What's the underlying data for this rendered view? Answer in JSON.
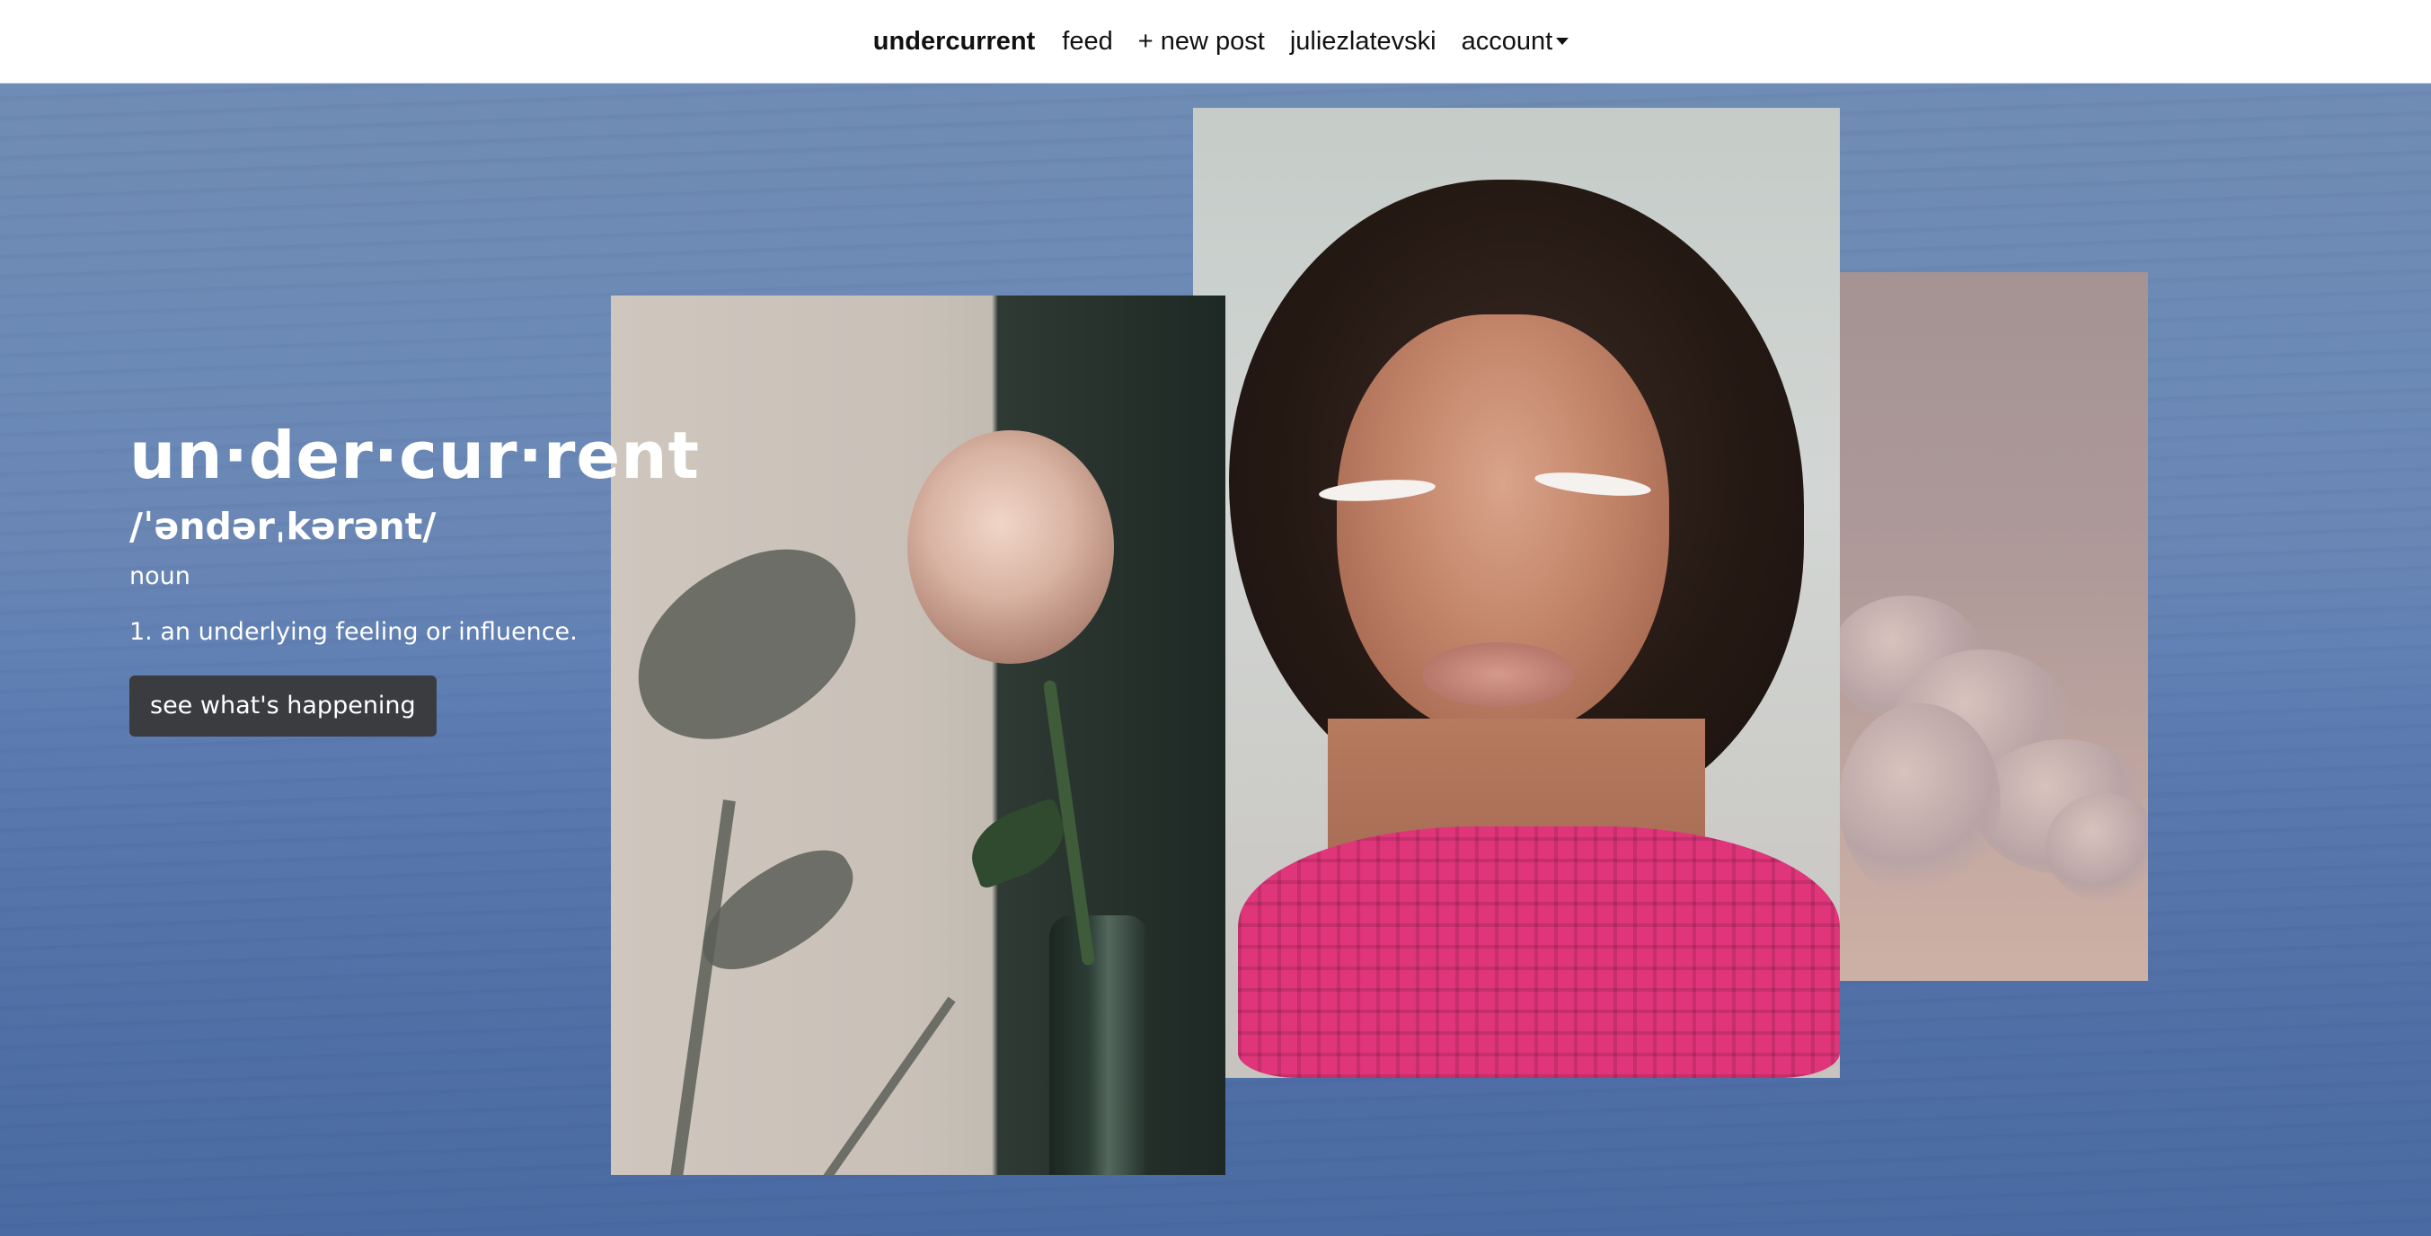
{
  "nav": {
    "brand": "undercurrent",
    "items": [
      {
        "label": "feed"
      },
      {
        "label": "+ new post"
      },
      {
        "label": "juliezlatevski"
      },
      {
        "label": "account"
      }
    ]
  },
  "definition": {
    "word": "un·der·cur·rent",
    "phonetic": "/ˈəndərˌkərənt/",
    "part_of_speech": "noun",
    "meaning": "1. an underlying feeling or influence.",
    "cta_label": "see what's happening"
  },
  "colors": {
    "nav_background": "#ffffff",
    "ocean": "#5a79ad",
    "button_background": "#3a3c40",
    "text_on_hero": "#ffffff",
    "knit_pink": "#e0357a"
  },
  "icons": {
    "account_dropdown": "caret-down-icon"
  }
}
